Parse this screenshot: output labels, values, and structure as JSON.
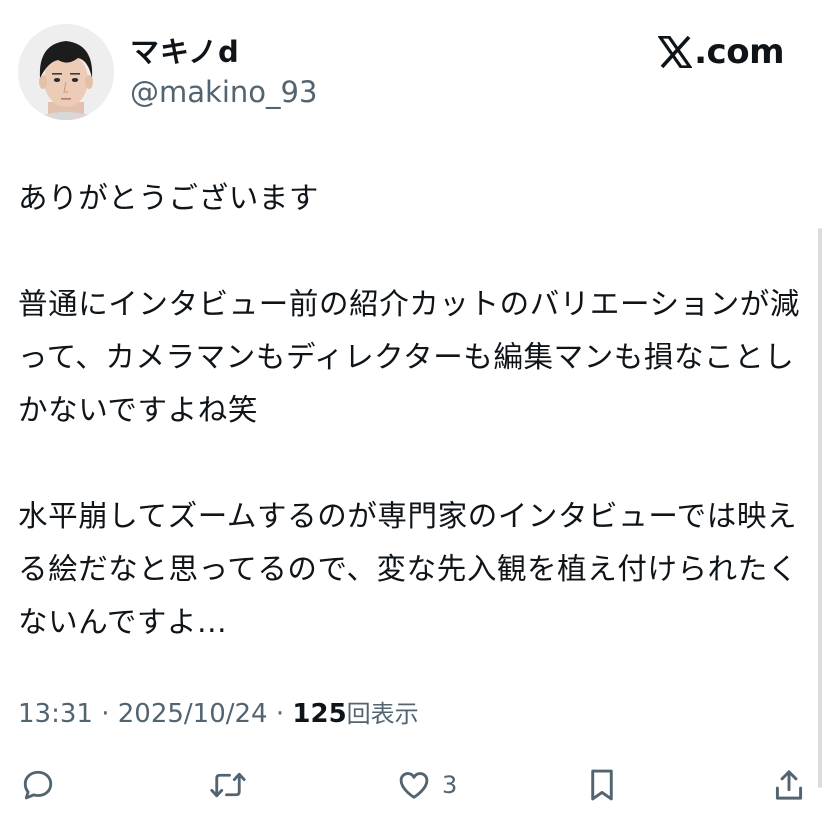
{
  "user": {
    "display_name": "マキノd",
    "handle": "@makino_93",
    "avatar_icon": "user-photo"
  },
  "brand": {
    "icon": "x-logo-icon",
    "site_text": ".com"
  },
  "tweet": {
    "paragraphs": [
      "ありがとうございます",
      "普通にインタビュー前の紹介カットのバリエーションが減って、カメラマンもディレクターも編集マンも損なことしかないですよね笑",
      "水平崩してズームするのが専門家のインタビューでは映える絵だなと思ってるので、変な先入観を植え付けられたくないんですよ..."
    ]
  },
  "meta": {
    "time": "13:31",
    "separator": " · ",
    "date": "2025/10/24",
    "views_count": "125",
    "views_label": "回表示"
  },
  "actions": {
    "reply_icon": "reply-icon",
    "retweet_icon": "retweet-icon",
    "like_icon": "heart-icon",
    "like_count": "3",
    "bookmark_icon": "bookmark-icon",
    "share_icon": "share-icon"
  },
  "colors": {
    "text": "#0f1419",
    "secondary": "#536471",
    "background": "#ffffff"
  }
}
